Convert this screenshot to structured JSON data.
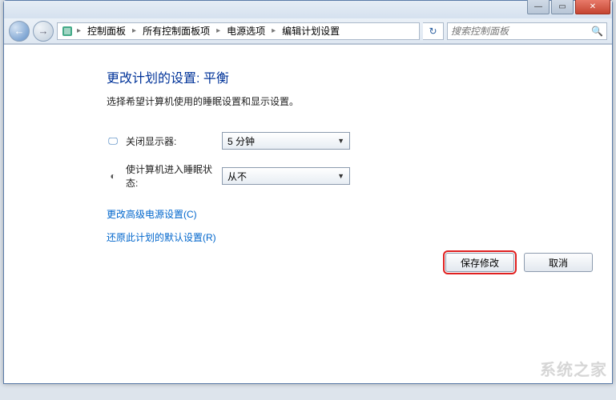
{
  "titlebar": {
    "minimize": "—",
    "maximize": "▭",
    "close": "✕"
  },
  "nav": {
    "back": "←",
    "forward": "→",
    "refresh": "↻"
  },
  "breadcrumb": {
    "items": [
      "控制面板",
      "所有控制面板项",
      "电源选项",
      "编辑计划设置"
    ]
  },
  "search": {
    "placeholder": "搜索控制面板"
  },
  "page": {
    "title": "更改计划的设置: 平衡",
    "description": "选择希望计算机使用的睡眠设置和显示设置。"
  },
  "settings": [
    {
      "icon": "🖵",
      "icon_color": "#2b6fb5",
      "label": "关闭显示器:",
      "value": "5 分钟"
    },
    {
      "icon": "◐",
      "icon_color": "#555",
      "label": "使计算机进入睡眠状态:",
      "value": "从不"
    }
  ],
  "links": {
    "advanced": "更改高级电源设置(C)",
    "restore": "还原此计划的默认设置(R)"
  },
  "buttons": {
    "save": "保存修改",
    "cancel": "取消"
  },
  "watermark": "系统之家"
}
